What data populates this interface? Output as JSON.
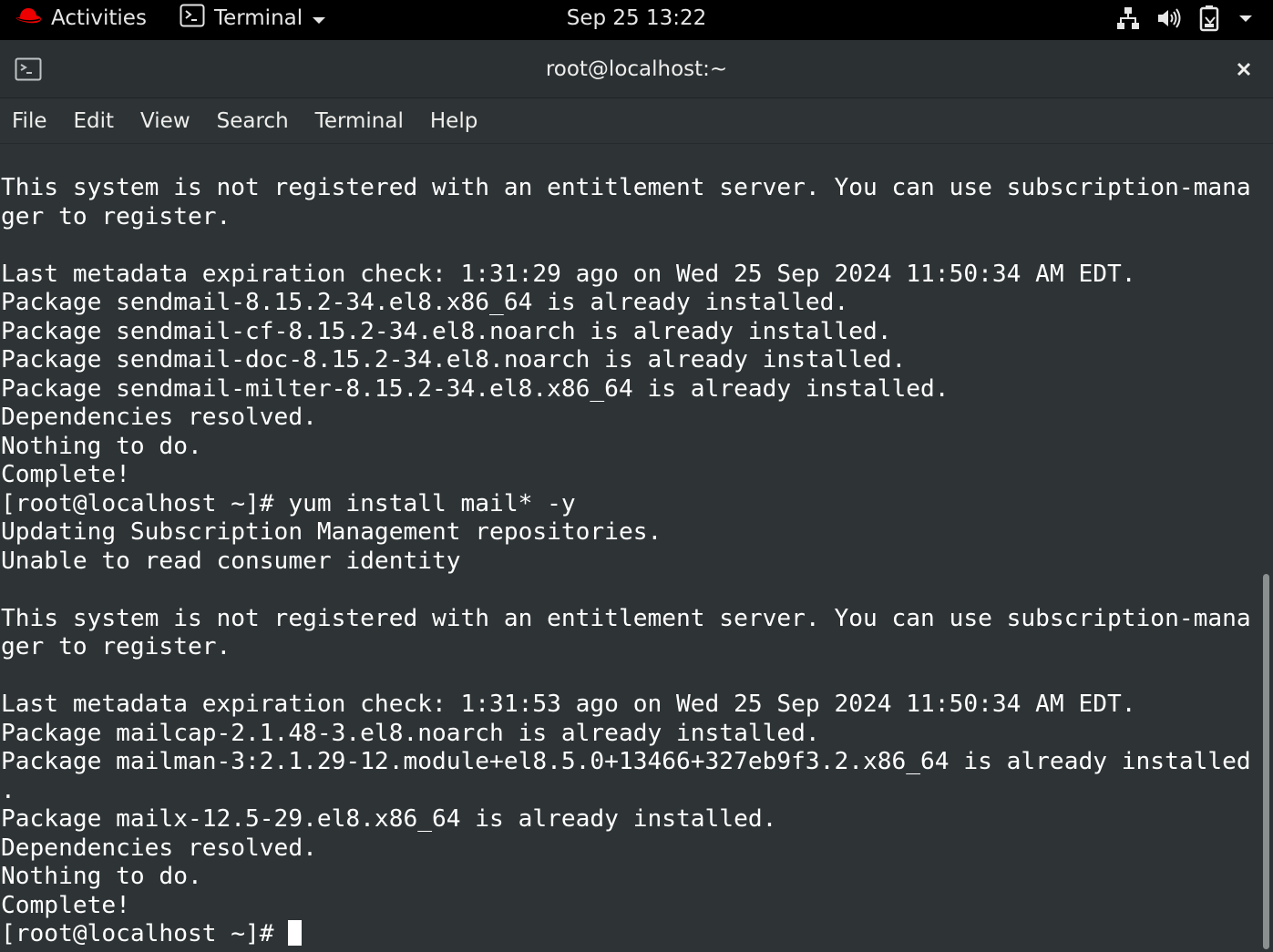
{
  "topbar": {
    "activities": "Activities",
    "app_menu": "Terminal",
    "clock": "Sep 25  13:22",
    "icons": [
      "redhat-logo-icon",
      "terminal-app-icon",
      "network-icon",
      "volume-icon",
      "battery-icon",
      "system-menu-caret-icon"
    ]
  },
  "window": {
    "title": "root@localhost:~",
    "close_label": "×"
  },
  "menubar": {
    "items": [
      "File",
      "Edit",
      "View",
      "Search",
      "Terminal",
      "Help"
    ]
  },
  "terminal": {
    "lines": [
      "This system is not registered with an entitlement server. You can use subscription-mana",
      "ger to register.",
      "",
      "Last metadata expiration check: 1:31:29 ago on Wed 25 Sep 2024 11:50:34 AM EDT.",
      "Package sendmail-8.15.2-34.el8.x86_64 is already installed.",
      "Package sendmail-cf-8.15.2-34.el8.noarch is already installed.",
      "Package sendmail-doc-8.15.2-34.el8.noarch is already installed.",
      "Package sendmail-milter-8.15.2-34.el8.x86_64 is already installed.",
      "Dependencies resolved.",
      "Nothing to do.",
      "Complete!",
      "[root@localhost ~]# yum install mail* -y",
      "Updating Subscription Management repositories.",
      "Unable to read consumer identity",
      "",
      "This system is not registered with an entitlement server. You can use subscription-mana",
      "ger to register.",
      "",
      "Last metadata expiration check: 1:31:53 ago on Wed 25 Sep 2024 11:50:34 AM EDT.",
      "Package mailcap-2.1.48-3.el8.noarch is already installed.",
      "Package mailman-3:2.1.29-12.module+el8.5.0+13466+327eb9f3.2.x86_64 is already installed",
      ".",
      "Package mailx-12.5-29.el8.x86_64 is already installed.",
      "Dependencies resolved.",
      "Nothing to do.",
      "Complete!"
    ],
    "prompt": "[root@localhost ~]# "
  },
  "colors": {
    "topbar_bg": "#000000",
    "terminal_bg": "#2e3436",
    "terminal_fg": "#ffffff",
    "redhat_red": "#ee0000"
  }
}
